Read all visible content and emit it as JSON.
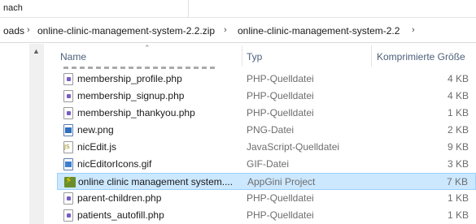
{
  "topbar": {
    "label": "nach"
  },
  "address": {
    "crumbs": [
      "oads",
      "online-clinic-management-system-2.2.zip",
      "online-clinic-management-system-2.2"
    ]
  },
  "columns": {
    "name": "Name",
    "type": "Typ",
    "size": "Komprimierte Größe"
  },
  "files": [
    {
      "name": "membership_profile.php",
      "type": "PHP-Quelldatei",
      "size": "4 KB",
      "icon": "php-file-icon"
    },
    {
      "name": "membership_signup.php",
      "type": "PHP-Quelldatei",
      "size": "4 KB",
      "icon": "php-file-icon"
    },
    {
      "name": "membership_thankyou.php",
      "type": "PHP-Quelldatei",
      "size": "1 KB",
      "icon": "php-file-icon"
    },
    {
      "name": "new.png",
      "type": "PNG-Datei",
      "size": "2 KB",
      "icon": "png-image-icon"
    },
    {
      "name": "nicEdit.js",
      "type": "JavaScript-Quelldatei",
      "size": "9 KB",
      "icon": "js-file-icon"
    },
    {
      "name": "nicEditorIcons.gif",
      "type": "GIF-Datei",
      "size": "3 KB",
      "icon": "gif-image-icon"
    },
    {
      "name": "online clinic management system....",
      "type": "AppGini Project",
      "size": "7 KB",
      "icon": "appgini-project-icon",
      "selected": true
    },
    {
      "name": "parent-children.php",
      "type": "PHP-Quelldatei",
      "size": "1 KB",
      "icon": "php-file-icon"
    },
    {
      "name": "patients_autofill.php",
      "type": "PHP-Quelldatei",
      "size": "1 KB",
      "icon": "php-file-icon"
    }
  ]
}
